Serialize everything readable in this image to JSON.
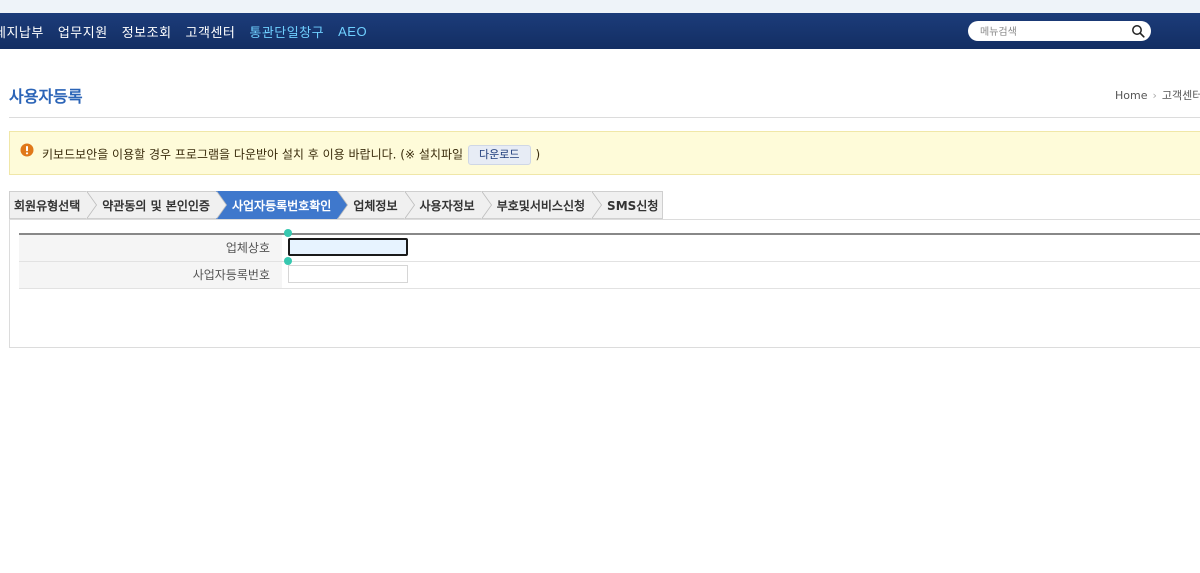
{
  "nav": {
    "items": [
      {
        "label": "세지납부",
        "active": false
      },
      {
        "label": "업무지원",
        "active": false
      },
      {
        "label": "정보조회",
        "active": false
      },
      {
        "label": "고객센터",
        "active": false
      },
      {
        "label": "통관단일창구",
        "active": true
      },
      {
        "label": "AEO",
        "active": true
      }
    ],
    "search_placeholder": "메뉴검색",
    "search_icon": "search-icon"
  },
  "page": {
    "title": "사용자등록",
    "breadcrumb": [
      "Home",
      "고객센터"
    ]
  },
  "notice": {
    "icon": "exclamation-icon",
    "text_before": "키보드보안을 이용할 경우 프로그램을 다운받아 설치 후 이용 바랍니다. (※ 설치파일",
    "download_label": "다운로드",
    "text_after": ")"
  },
  "steps": [
    {
      "label": "회원유형선택",
      "active": false
    },
    {
      "label": "약관동의 및 본인인증",
      "active": false
    },
    {
      "label": "사업자등록번호확인",
      "active": true
    },
    {
      "label": "업체정보",
      "active": false
    },
    {
      "label": "사용자정보",
      "active": false
    },
    {
      "label": "부호및서비스신청",
      "active": false
    },
    {
      "label": "SMS신청",
      "active": false
    }
  ],
  "form": {
    "company_name_label": "업체상호",
    "company_name_value": "",
    "business_number_label": "사업자등록번호",
    "business_number_value": ""
  },
  "colors": {
    "nav_bg": "#1c3c7a",
    "nav_active": "#6fd0ff",
    "title": "#2b64b7",
    "step_active": "#3f78cc",
    "notice_bg": "#fefbd9"
  }
}
